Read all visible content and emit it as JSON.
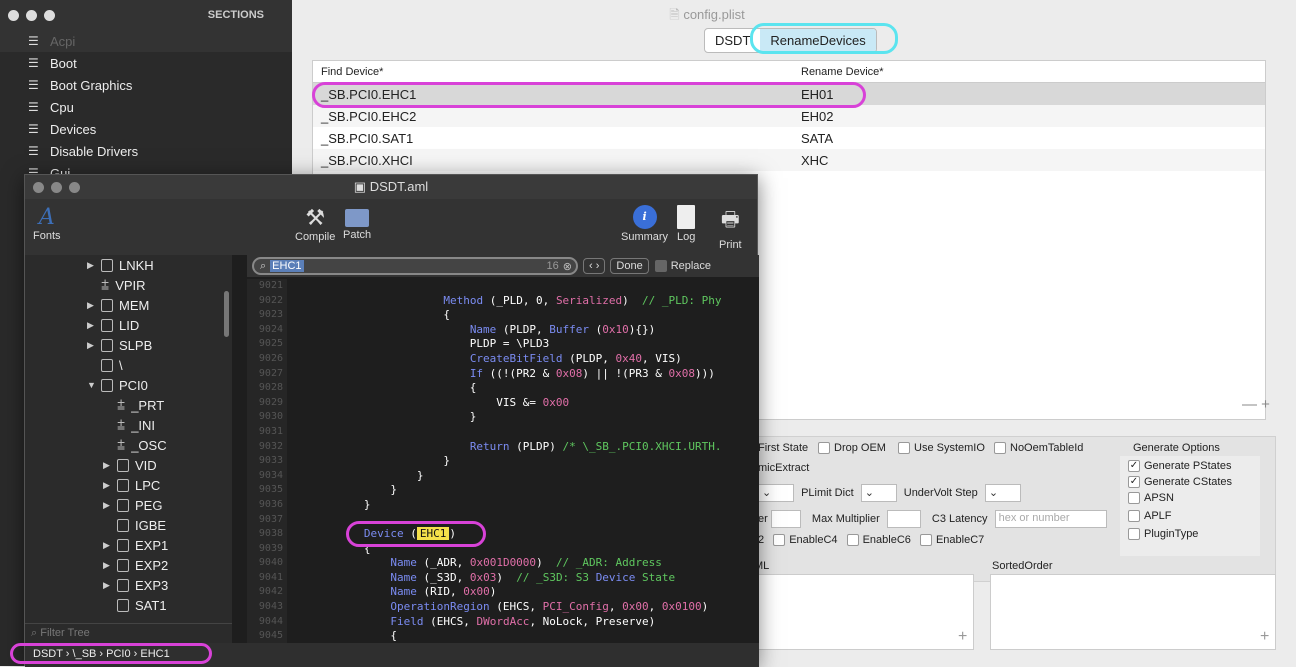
{
  "sidebar": {
    "header": "SECTIONS",
    "items": [
      "Acpi",
      "Boot",
      "Boot Graphics",
      "Cpu",
      "Devices",
      "Disable Drivers",
      "Gui"
    ]
  },
  "main": {
    "title": "config.plist",
    "tabs": [
      "DSDT",
      "RenameDevices"
    ],
    "table": {
      "headers": [
        "Find Device*",
        "Rename Device*"
      ],
      "rows": [
        [
          "_SB.PCI0.EHC1",
          "EH01"
        ],
        [
          "_SB.PCI0.EHC2",
          "EH02"
        ],
        [
          "_SB.PCI0.SAT1",
          "SATA"
        ],
        [
          "_SB.PCI0.XHCI",
          "XHC"
        ]
      ]
    },
    "plus_minus": "— +",
    "options": {
      "row1": [
        "First State",
        "Drop OEM",
        "Use SystemIO",
        "NoOemTableId"
      ],
      "row2": "micExtract",
      "plimit": "PLimit Dict",
      "undervolt": "UnderVolt Step",
      "row4a": "er",
      "maxmult": "Max Multiplier",
      "c3": "C3 Latency",
      "c3_placeholder": "hex or number",
      "row5": [
        "2",
        "EnableC4",
        "EnableC6",
        "EnableC7"
      ]
    },
    "generate": {
      "title": "Generate Options",
      "items": [
        {
          "label": "Generate PStates",
          "checked": true
        },
        {
          "label": "Generate CStates",
          "checked": true
        },
        {
          "label": "APSN",
          "checked": false
        },
        {
          "label": "APLF",
          "checked": false
        },
        {
          "label": "PluginType",
          "checked": false
        }
      ]
    },
    "ml_label": "ML",
    "sorted_label": "SortedOrder"
  },
  "editor": {
    "title": "DSDT.aml",
    "toolbar": {
      "fonts": "Fonts",
      "compile": "Compile",
      "patch": "Patch",
      "summary": "Summary",
      "log": "Log",
      "print": "Print"
    },
    "search": {
      "value": "EHC1",
      "count": "16",
      "done": "Done",
      "replace": "Replace"
    },
    "tree": [
      {
        "label": "LNKH",
        "indent": 1,
        "kind": "fold",
        "arrow": "▶"
      },
      {
        "label": "VPIR",
        "indent": 1,
        "kind": "method",
        "arrow": ""
      },
      {
        "label": "MEM",
        "indent": 1,
        "kind": "fold",
        "arrow": "▶"
      },
      {
        "label": "LID",
        "indent": 1,
        "kind": "fold",
        "arrow": "▶"
      },
      {
        "label": "SLPB",
        "indent": 1,
        "kind": "fold",
        "arrow": "▶"
      },
      {
        "label": "\\",
        "indent": 1,
        "kind": "fold",
        "arrow": ""
      },
      {
        "label": "PCI0",
        "indent": 1,
        "kind": "fold",
        "arrow": "▼"
      },
      {
        "label": "_PRT",
        "indent": 2,
        "kind": "method",
        "arrow": ""
      },
      {
        "label": "_INI",
        "indent": 2,
        "kind": "method",
        "arrow": ""
      },
      {
        "label": "_OSC",
        "indent": 2,
        "kind": "method",
        "arrow": ""
      },
      {
        "label": "VID",
        "indent": 2,
        "kind": "fold",
        "arrow": "▶"
      },
      {
        "label": "LPC",
        "indent": 2,
        "kind": "fold",
        "arrow": "▶"
      },
      {
        "label": "PEG",
        "indent": 2,
        "kind": "fold",
        "arrow": "▶"
      },
      {
        "label": "IGBE",
        "indent": 2,
        "kind": "fold",
        "arrow": ""
      },
      {
        "label": "EXP1",
        "indent": 2,
        "kind": "fold",
        "arrow": "▶"
      },
      {
        "label": "EXP2",
        "indent": 2,
        "kind": "fold",
        "arrow": "▶"
      },
      {
        "label": "EXP3",
        "indent": 2,
        "kind": "fold",
        "arrow": "▶"
      },
      {
        "label": "SAT1",
        "indent": 2,
        "kind": "fold",
        "arrow": ""
      }
    ],
    "filter": "Filter Tree",
    "line_numbers": [
      "9021",
      "9022",
      "9023",
      "9024",
      "9025",
      "9026",
      "9027",
      "9028",
      "9029",
      "9030",
      "9031",
      "9032",
      "9033",
      "9034",
      "9035",
      "9036",
      "9037",
      "9038",
      "9039",
      "9040",
      "9041",
      "9042",
      "9043",
      "9044",
      "9045"
    ],
    "code": [
      "",
      "                       Method (_PLD, 0, Serialized)  // _PLD: Phy",
      "                       {",
      "                           Name (PLDP, Buffer (0x10){})",
      "                           PLDP = \\PLD3",
      "                           CreateBitField (PLDP, 0x40, VIS)",
      "                           If ((!(PR2 & 0x08) || !(PR3 & 0x08)))",
      "                           {",
      "                               VIS &= 0x00",
      "                           }",
      "",
      "                           Return (PLDP) /* \\_SB_.PCI0.XHCI.URTH.",
      "                       }",
      "                   }",
      "               }",
      "           }",
      "",
      "           Device (EHC1)",
      "           {",
      "               Name (_ADR, 0x001D0000)  // _ADR: Address",
      "               Name (_S3D, 0x03)  // _S3D: S3 Device State",
      "               Name (RID, 0x00)",
      "               OperationRegion (EHCS, PCI_Config, 0x00, 0x0100)",
      "               Field (EHCS, DWordAcc, NoLock, Preserve)",
      "               {"
    ],
    "status": "DSDT › \\_SB › PCI0 › EHC1"
  }
}
